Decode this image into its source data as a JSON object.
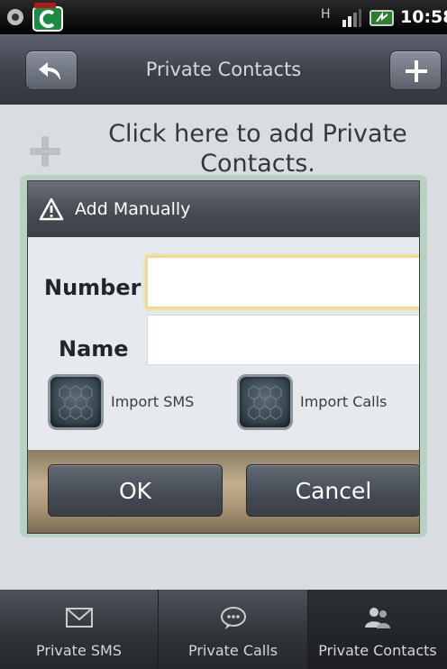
{
  "status_bar": {
    "time": "10:58",
    "network_label": "H",
    "icons": [
      "settings-icon",
      "app-icon",
      "signal-icon",
      "battery-icon"
    ]
  },
  "header": {
    "title": "Private Contacts",
    "back_icon": "back-arrow-icon",
    "add_icon": "plus-icon"
  },
  "content": {
    "add_prompt": "Click here to add Private Contacts."
  },
  "dialog": {
    "title": "Add Manually",
    "title_icon": "warning-icon",
    "number_label": "Number",
    "number_value": "",
    "name_label": "Name",
    "name_value": "",
    "import_sms_label": "Import SMS",
    "import_calls_label": "Import Calls",
    "ok_label": "OK",
    "cancel_label": "Cancel"
  },
  "tabs": [
    {
      "label": "Private SMS",
      "icon": "sms-icon",
      "active": false
    },
    {
      "label": "Private Calls",
      "icon": "calls-icon",
      "active": false
    },
    {
      "label": "Private Contacts",
      "icon": "contacts-icon",
      "active": true
    }
  ],
  "colors": {
    "accent_focus": "#f3d98e",
    "dialog_glow": "#78be8c",
    "footer_brown": "#c1ae8e"
  }
}
